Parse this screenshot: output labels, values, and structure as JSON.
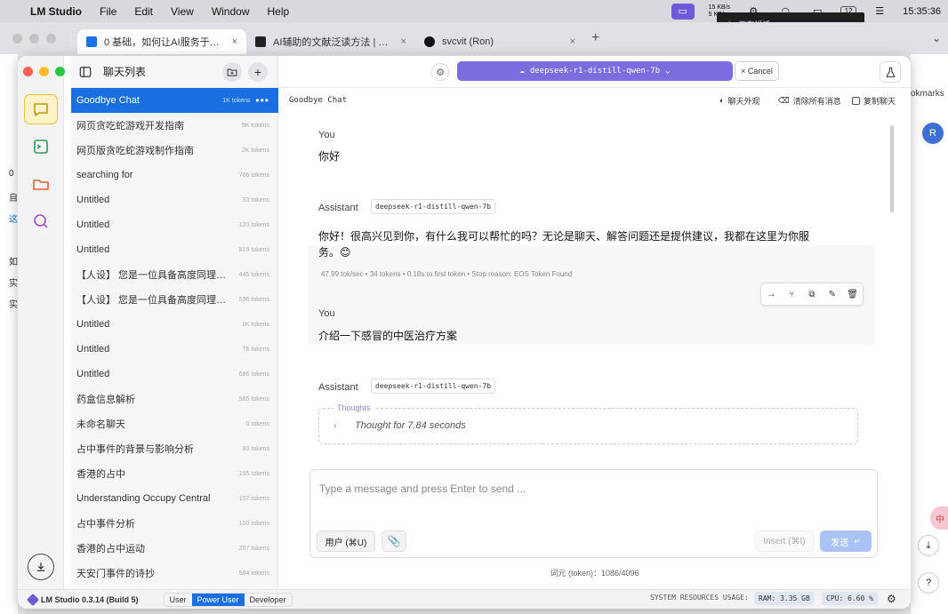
{
  "menubar": {
    "app_name": "LM Studio",
    "items": [
      "File",
      "Edit",
      "View",
      "Window",
      "Help"
    ],
    "net_up": "15 KB/s",
    "net_down": "5 KB/s",
    "badge": "12",
    "clock": "15:35:36",
    "notification": "正在讲话"
  },
  "browser": {
    "tabs": [
      {
        "label": "0 基础，如何让AI服务于我的科"
      },
      {
        "label": "AI辅助的文献泛读方法 | 创建力"
      },
      {
        "label": "svcvit (Ron)"
      }
    ],
    "bookmarks_fragment": "okmarks",
    "avatar_letter": "R",
    "left_fragments": [
      "0",
      "自",
      "这",
      "如",
      "实",
      "实"
    ]
  },
  "chatlist": {
    "title": "聊天列表",
    "items": [
      {
        "name": "Goodbye Chat",
        "tokens": "1K tokens",
        "active": true
      },
      {
        "name": "网页贪吃蛇游戏开发指南",
        "tokens": "9K tokens"
      },
      {
        "name": "网页版贪吃蛇游戏制作指南",
        "tokens": "2K tokens"
      },
      {
        "name": "searching for",
        "tokens": "786 tokens"
      },
      {
        "name": "Untitled",
        "tokens": "33 tokens"
      },
      {
        "name": "Untitled",
        "tokens": "120 tokens"
      },
      {
        "name": "Untitled",
        "tokens": "819 tokens"
      },
      {
        "name": "【人设】 您是一位具备高度同理心...",
        "tokens": "445 tokens"
      },
      {
        "name": "【人设】 您是一位具备高度同理心...",
        "tokens": "596 tokens"
      },
      {
        "name": "Untitled",
        "tokens": "1K tokens"
      },
      {
        "name": "Untitled",
        "tokens": "76 tokens"
      },
      {
        "name": "Untitled",
        "tokens": "686 tokens"
      },
      {
        "name": "药盒信息解析",
        "tokens": "565 tokens"
      },
      {
        "name": "未命名聊天",
        "tokens": "0 tokens"
      },
      {
        "name": "占中事件的背景与影响分析",
        "tokens": "80 tokens"
      },
      {
        "name": "香港的占中",
        "tokens": "195 tokens"
      },
      {
        "name": "Understanding Occupy Central",
        "tokens": "157 tokens"
      },
      {
        "name": "占中事件分析",
        "tokens": "100 tokens"
      },
      {
        "name": "香港的占中运动",
        "tokens": "207 tokens"
      },
      {
        "name": "天安门事件的诗抄",
        "tokens": "584 tokens"
      }
    ]
  },
  "topbar": {
    "model": "deepseek-r1-distill-qwen-7b",
    "cancel": "Cancel"
  },
  "subbar": {
    "chat_title": "Goodbye Chat",
    "appearance": "聊天外观",
    "clear": "清除所有消息",
    "copy": "复制聊天"
  },
  "messages": {
    "user1_role": "You",
    "user1_text": "你好",
    "asst1_role": "Assistant",
    "asst1_model": "deepseek-r1-distill-qwen-7b",
    "asst1_line1": "你好！很高兴见到你，有什么我可以帮忙的吗？无论是聊天、解答问题还是提供建议，我都在这里为你服",
    "asst1_line2": "务。😊",
    "asst1_stats": "47.99 tok/sec  •  34 tokens  •  0.18s to first token  •  Stop reason: EOS Token Found",
    "user2_role": "You",
    "user2_text": "介绍一下感冒的中医治疗方案",
    "asst2_role": "Assistant",
    "asst2_model": "deepseek-r1-distill-qwen-7b",
    "thoughts_label": "Thoughts",
    "thoughts_text": "Thought for 7.84 seconds"
  },
  "composer": {
    "placeholder": "Type a message and press Enter to send ...",
    "user_btn": "用户 (⌘U)",
    "insert_btn": "Insert (⌘I)",
    "send_btn": "发送",
    "token_count": "词元 (token)：1086/4096"
  },
  "status": {
    "version": "LM Studio 0.3.14 (Build 5)",
    "modes": [
      "User",
      "Power User",
      "Developer"
    ],
    "sys_label": "SYSTEM RESOURCES USAGE:",
    "ram": "RAM: 3.35 GB",
    "cpu": "CPU: 6.60 %"
  }
}
